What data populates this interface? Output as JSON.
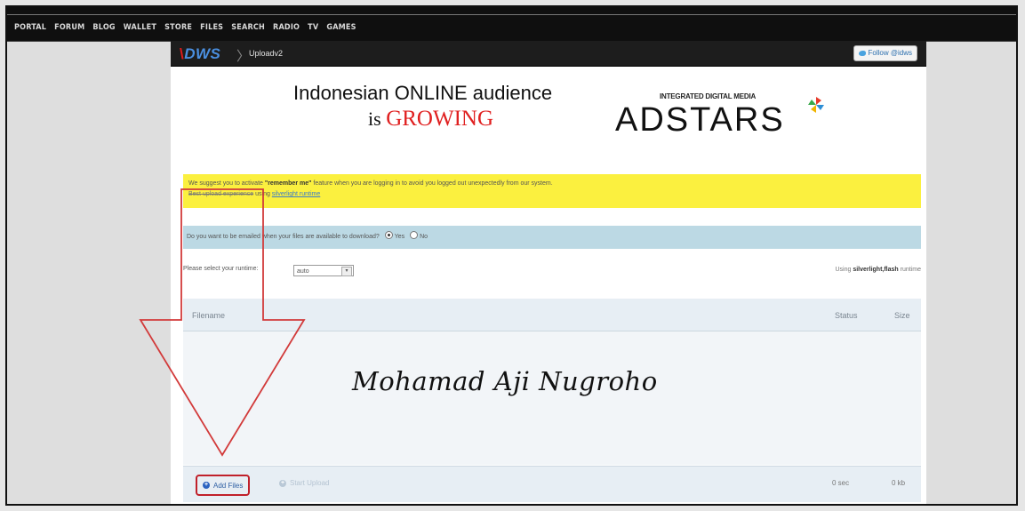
{
  "topnav": {
    "links": [
      "PORTAL",
      "FORUM",
      "BLOG",
      "WALLET",
      "STORE",
      "FILES",
      "SEARCH",
      "RADIO",
      "TV",
      "GAMES"
    ]
  },
  "header": {
    "logo_slash": "\\",
    "logo_text": "DWS",
    "breadcrumb": "Uploadv2",
    "follow_button": "Follow @idws"
  },
  "banner": {
    "line1": "Indonesian ONLINE audience",
    "line2_prefix": "is ",
    "line2_highlight": "GROWING",
    "brand_tagline": "INTEGRATED DIGITAL MEDIA",
    "brand_name": "ADSTARS"
  },
  "notice": {
    "pre": "We suggest you to activate ",
    "bold": "\"remember me\"",
    "post": " feature when you are logging in to avoid you logged out unexpectedly from our system.",
    "line2_struck": "Best upload experience",
    "line2_mid": " using ",
    "line2_link": "silverlight runtime"
  },
  "email_prompt": {
    "question": "Do you want to be emailed when your files are available to download?",
    "yes": "Yes",
    "no": "No",
    "selected": "Yes"
  },
  "runtime": {
    "label": "Please select your runtime:",
    "value": "auto",
    "using_pre": "Using ",
    "using_bold": "silverlight,flash",
    "using_post": " runtime"
  },
  "file_table": {
    "col_filename": "Filename",
    "col_status": "Status",
    "col_size": "Size"
  },
  "dropzone": {
    "signature": "Mohamad Aji Nugroho"
  },
  "footer": {
    "add_files": "Add Files",
    "start_upload": "Start Upload",
    "time": "0 sec",
    "size": "0 kb"
  },
  "colors": {
    "notice_bg": "#fbf03f",
    "email_bg": "#bcd9e4",
    "highlight_red": "#e02020",
    "annotation_red": "#c0202a"
  },
  "icons": [
    "twitter-icon",
    "plus-icon",
    "pinwheel-icon",
    "down-arrow-annotation"
  ]
}
